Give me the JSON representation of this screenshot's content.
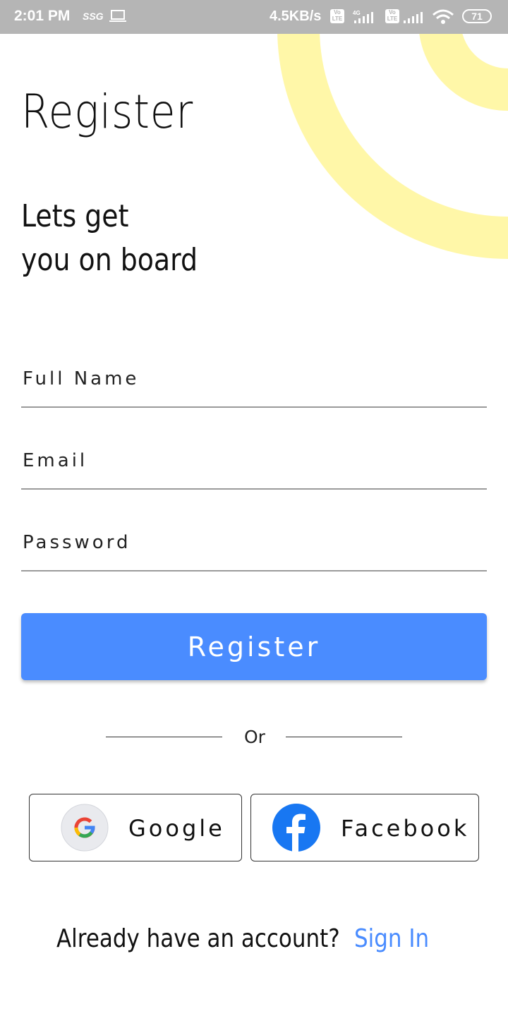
{
  "status_bar": {
    "time": "2:01 PM",
    "carrier_tag": "SSG",
    "speed": "4.5KB/s",
    "network_type": "4G",
    "lte_badge": "Vo LTE",
    "battery": "71"
  },
  "page": {
    "title": "Register",
    "subtitle_line1": "Lets get",
    "subtitle_line2": "you on board"
  },
  "form": {
    "full_name_label": "Full Name",
    "email_label": "Email",
    "password_label": "Password",
    "register_label": "Register"
  },
  "divider": {
    "text": "Or"
  },
  "social": {
    "google_label": "Google",
    "facebook_label": "Facebook"
  },
  "footer": {
    "prompt": "Already have an account?",
    "signin_label": "Sign In"
  },
  "colors": {
    "accent": "#4a8cff",
    "ring": "#fff7a8",
    "status_bar": "#b5b5b5",
    "facebook_blue": "#1877f2"
  },
  "icons": [
    "laptop-icon",
    "signal-icon",
    "wifi-icon",
    "battery-icon",
    "google-icon",
    "facebook-icon"
  ]
}
